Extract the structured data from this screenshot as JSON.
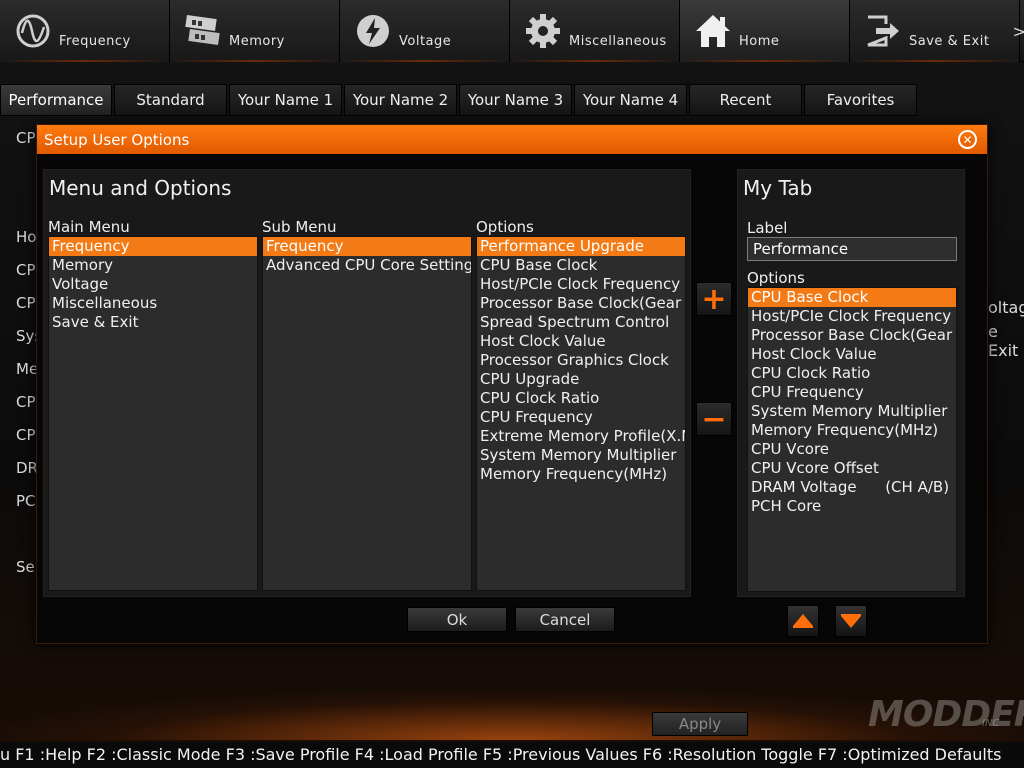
{
  "nav": {
    "items": [
      {
        "label": "Frequency",
        "icon": "frequency-gauge-icon"
      },
      {
        "label": "Memory",
        "icon": "memory-chip-icon"
      },
      {
        "label": "Voltage",
        "icon": "lightning-bolt-icon"
      },
      {
        "label": "Miscellaneous",
        "icon": "gear-icon"
      },
      {
        "label": "Home",
        "icon": "house-icon"
      },
      {
        "label": "Save & Exit",
        "icon": "exit-icon"
      }
    ],
    "more_arrow": ">"
  },
  "tabs": [
    "Performance",
    "Standard",
    "Your Name 1",
    "Your Name 2",
    "Your Name 3",
    "Your Name 4",
    "Recent",
    "Favorites"
  ],
  "background": {
    "left_labels": [
      "CP",
      "Ho",
      "CP",
      "CP",
      "Sys",
      "Me",
      "CP",
      "CP",
      "DR",
      "PC",
      "Se"
    ],
    "right_labels": [
      "oltag",
      "e Exit"
    ]
  },
  "dialog": {
    "title": "Setup User Options",
    "menu_heading": "Menu and Options",
    "main_menu": {
      "header": "Main Menu",
      "items": [
        "Frequency",
        "Memory",
        "Voltage",
        "Miscellaneous",
        "Save & Exit"
      ],
      "selected": 0
    },
    "sub_menu": {
      "header": "Sub Menu",
      "items": [
        "Frequency",
        "Advanced CPU Core Settings"
      ],
      "selected": 0
    },
    "options": {
      "header": "Options",
      "items": [
        "Performance Upgrade",
        "CPU Base Clock",
        "Host/PCIe Clock Frequency",
        "Processor Base Clock(Gear Ratio)",
        "Spread Spectrum Control",
        "Host Clock Value",
        "Processor Graphics Clock",
        "CPU Upgrade",
        "CPU Clock Ratio",
        "CPU Frequency",
        "Extreme Memory Profile(X.M.P.)",
        "System Memory Multiplier",
        "Memory Frequency(MHz)"
      ],
      "selected": 0
    },
    "add_symbol": "+",
    "remove_symbol": "−",
    "my_tab": {
      "heading": "My Tab",
      "label_header": "Label",
      "label_value": "Performance",
      "options_header": "Options",
      "items": [
        "CPU Base Clock",
        "Host/PCIe Clock Frequency",
        "Processor Base Clock(Gear Ratio)",
        "Host Clock Value",
        "CPU Clock Ratio",
        "CPU Frequency",
        "System Memory Multiplier",
        "Memory Frequency(MHz)",
        "CPU Vcore",
        "CPU Vcore Offset",
        "DRAM Voltage      (CH A/B)",
        "PCH Core"
      ],
      "selected": 0
    },
    "ok_label": "Ok",
    "cancel_label": "Cancel"
  },
  "apply_label": "Apply",
  "hotkeys": "u F1 :Help F2 :Classic Mode F3 :Save Profile F4 :Load Profile F5 :Previous Values F6 :Resolution Toggle F7 :Optimized Defaults",
  "watermark": {
    "text": "MODDERS",
    "sub": "INC"
  },
  "colors": {
    "accent": "#f37a14",
    "title_bar": "#ff7a10",
    "panel": "#191919",
    "list_bg": "#2c2c2c"
  }
}
